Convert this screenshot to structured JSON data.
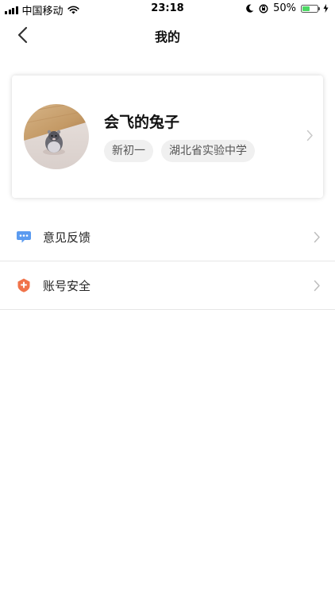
{
  "status_bar": {
    "carrier": "中国移动",
    "time": "23:18",
    "battery_percent": "50%",
    "battery_level": 0.5,
    "icons": [
      "signal-icon",
      "wifi-icon",
      "moon-icon",
      "rotation-lock-icon",
      "battery-icon",
      "charging-icon"
    ]
  },
  "nav": {
    "title": "我的",
    "back_icon": "chevron-left-icon"
  },
  "profile": {
    "name": "会飞的兔子",
    "tags": [
      "新初一",
      "湖北省实验中学"
    ],
    "avatar": "hamster-photo",
    "chevron_icon": "chevron-right-icon"
  },
  "menu": {
    "items": [
      {
        "label": "意见反馈",
        "icon": "feedback-chat-icon",
        "color": "#5b9bf0"
      },
      {
        "label": "账号安全",
        "icon": "shield-icon",
        "color": "#f0734a"
      }
    ]
  },
  "colors": {
    "tag_bg": "#f0f0f0",
    "divider": "#e6e6e6",
    "battery_green": "#4cd964"
  }
}
